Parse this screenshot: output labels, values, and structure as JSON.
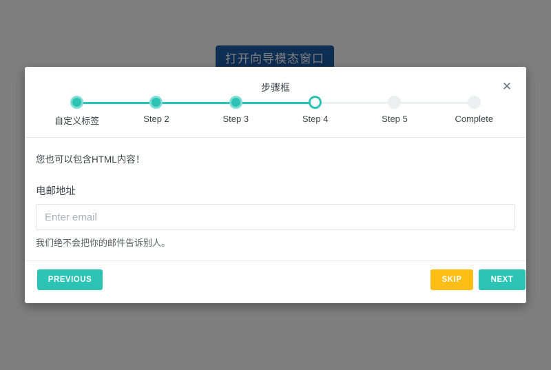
{
  "page": {
    "open_wizard_button": "打开向导模态窗口"
  },
  "modal": {
    "title": "步骤框",
    "close_icon": "close-icon",
    "close_glyph": "✕",
    "stepper": {
      "steps": [
        {
          "label": "自定义标签",
          "state": "done"
        },
        {
          "label": "Step 2",
          "state": "done"
        },
        {
          "label": "Step 3",
          "state": "done"
        },
        {
          "label": "Step 4",
          "state": "current"
        },
        {
          "label": "Step 5",
          "state": "pending"
        },
        {
          "label": "Complete",
          "state": "pending"
        }
      ]
    },
    "body": {
      "html_note": "您也可以包含HTML内容！",
      "email_label": "电邮地址",
      "email_placeholder": "Enter email",
      "email_value": "",
      "help_text": "我们绝不会把你的邮件告诉别人。"
    },
    "footer": {
      "previous_label": "PREVIOUS",
      "skip_label": "SKIP",
      "next_label": "NEXT"
    }
  },
  "colors": {
    "accent_teal": "#2cc3b5",
    "accent_amber": "#fcbe14",
    "page_button_blue": "#1c5ca8",
    "pending_gray": "#eceeef",
    "backdrop": "#808080"
  }
}
